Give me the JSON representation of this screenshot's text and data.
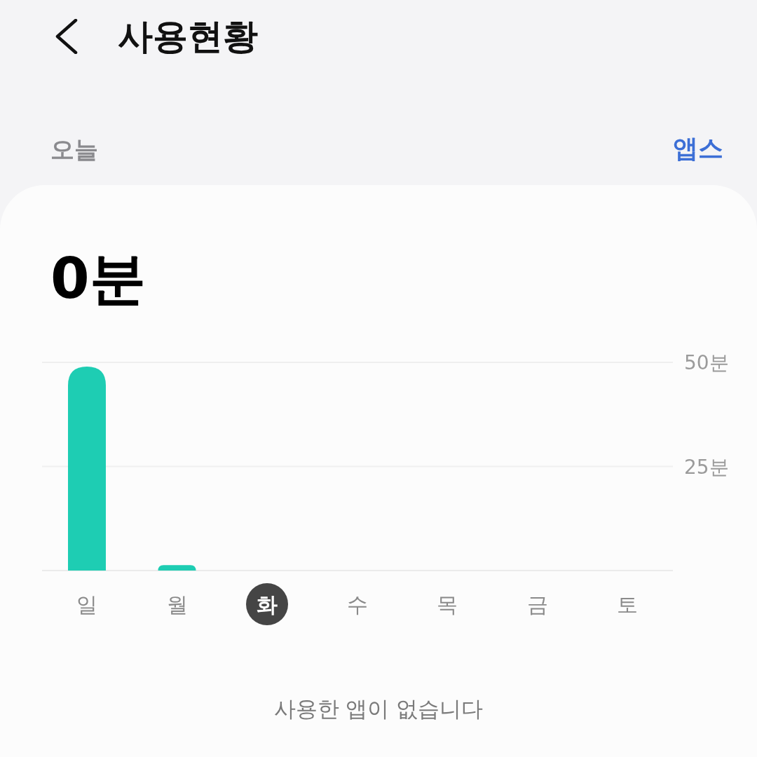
{
  "header": {
    "title": "사용현황"
  },
  "period": {
    "label": "오늘"
  },
  "apps_link": {
    "label": "앱스"
  },
  "card": {
    "total": "0분",
    "chart_data": {
      "type": "bar",
      "categories": [
        "일",
        "월",
        "화",
        "수",
        "목",
        "금",
        "토"
      ],
      "values": [
        49,
        1.3,
        0,
        null,
        null,
        null,
        null
      ],
      "ylim": [
        0,
        50
      ],
      "yticks": [
        {
          "value": 25,
          "label": "25분"
        },
        {
          "value": 50,
          "label": "50분"
        }
      ]
    },
    "day_tabs": [
      {
        "selected": false
      },
      {
        "selected": false
      },
      {
        "selected": true
      },
      {
        "selected": false
      },
      {
        "selected": false
      },
      {
        "selected": false
      },
      {
        "selected": false
      }
    ],
    "empty_message": "사용한 앱이 없습니다"
  }
}
